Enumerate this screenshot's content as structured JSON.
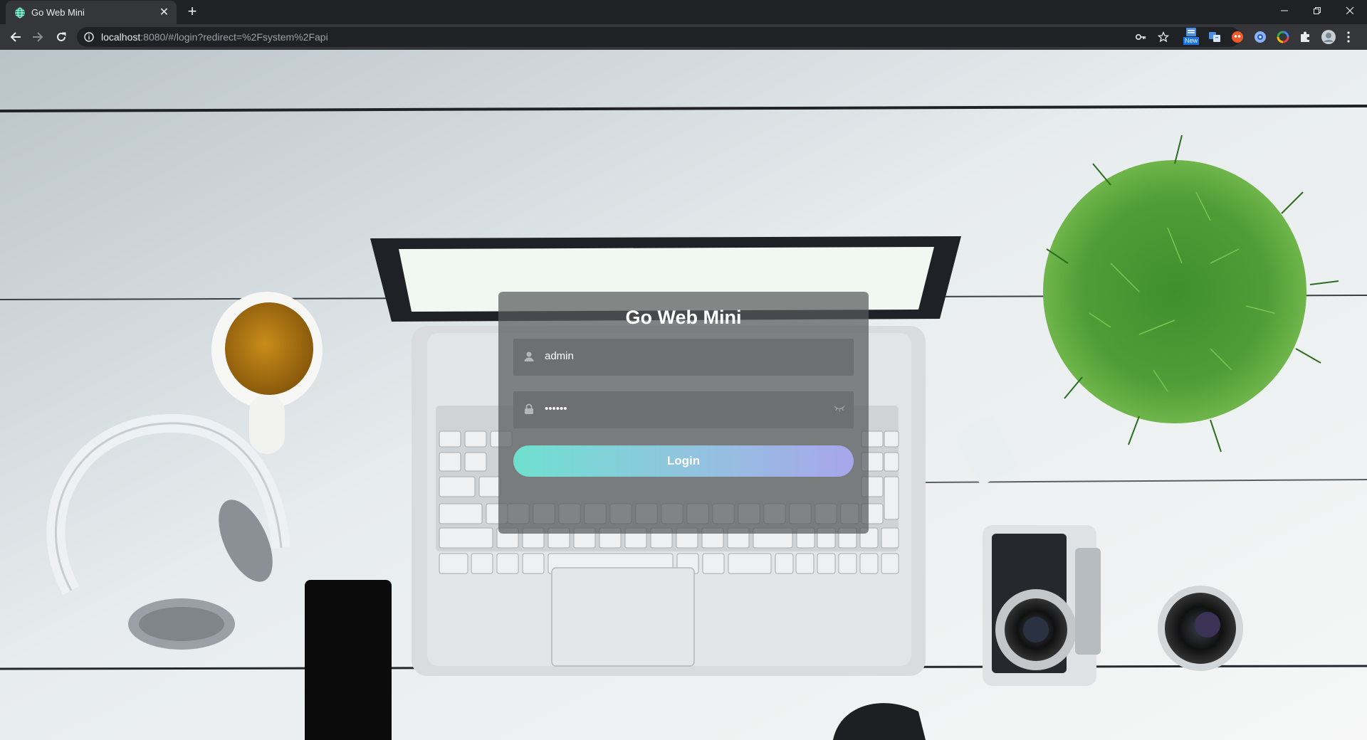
{
  "browser": {
    "tab_title": "Go Web Mini",
    "tab_close": "✕",
    "new_tab": "+",
    "url_host": "localhost",
    "url_rest": ":8080/#/login?redirect=%2Fsystem%2Fapi",
    "extension_badge": "New"
  },
  "login": {
    "title": "Go Web Mini",
    "username_value": "admin",
    "password_value": "••••••",
    "button_label": "Login"
  },
  "colors": {
    "button_gradient_start": "#6fe0cf",
    "button_gradient_end": "#a8a6ea",
    "panel_background": "#585a5c"
  },
  "icons": {
    "username": "user-icon",
    "password": "lock-icon",
    "toggle_password": "eye-closed-icon"
  }
}
